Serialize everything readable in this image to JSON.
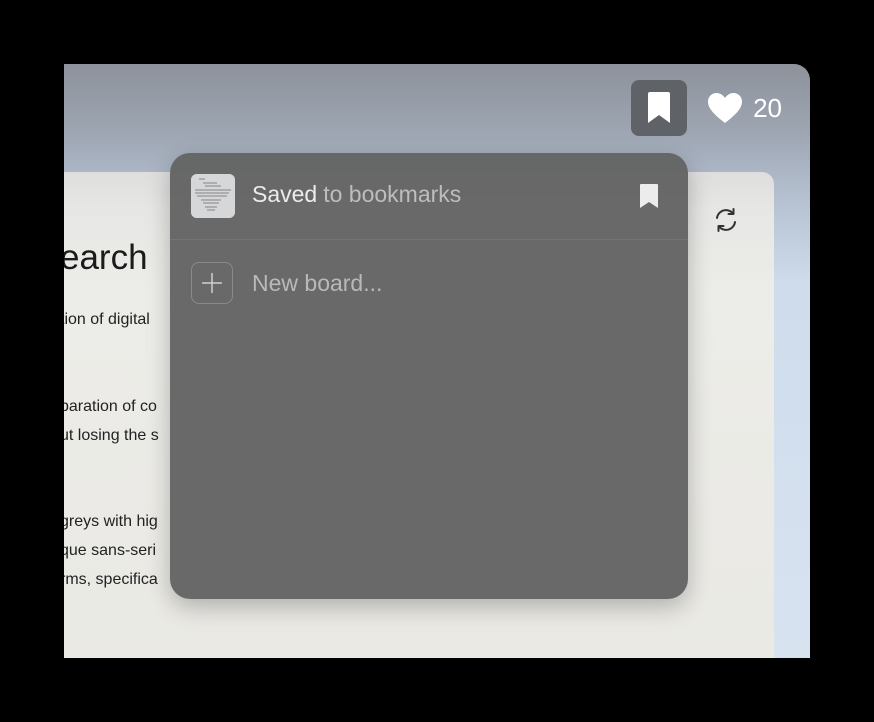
{
  "header": {
    "bookmark_icon": "bookmark-icon",
    "like_icon": "heart-icon",
    "like_count": "20"
  },
  "article": {
    "heading": "earch",
    "p1_lines": [
      "tion of digital"
    ],
    "p2_lines": [
      "paration of co",
      "ut losing the s"
    ],
    "p3_lines": [
      "greys with hig",
      "que sans-seri",
      "rms, specifica"
    ],
    "refresh_icon": "refresh-icon"
  },
  "popover": {
    "saved_label": "Saved",
    "saved_sub": "to bookmarks",
    "new_board_placeholder": "New board..."
  },
  "colors": {
    "popover_bg": "#646464",
    "bookmark_button_bg": "#5f6368"
  }
}
